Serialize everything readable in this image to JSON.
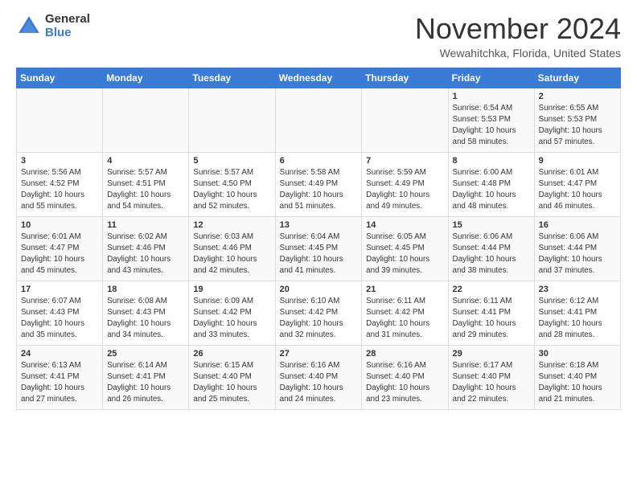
{
  "logo": {
    "general": "General",
    "blue": "Blue"
  },
  "title": "November 2024",
  "location": "Wewahitchka, Florida, United States",
  "weekdays": [
    "Sunday",
    "Monday",
    "Tuesday",
    "Wednesday",
    "Thursday",
    "Friday",
    "Saturday"
  ],
  "weeks": [
    [
      {
        "day": "",
        "info": ""
      },
      {
        "day": "",
        "info": ""
      },
      {
        "day": "",
        "info": ""
      },
      {
        "day": "",
        "info": ""
      },
      {
        "day": "",
        "info": ""
      },
      {
        "day": "1",
        "info": "Sunrise: 6:54 AM\nSunset: 5:53 PM\nDaylight: 10 hours\nand 58 minutes."
      },
      {
        "day": "2",
        "info": "Sunrise: 6:55 AM\nSunset: 5:53 PM\nDaylight: 10 hours\nand 57 minutes."
      }
    ],
    [
      {
        "day": "3",
        "info": "Sunrise: 5:56 AM\nSunset: 4:52 PM\nDaylight: 10 hours\nand 55 minutes."
      },
      {
        "day": "4",
        "info": "Sunrise: 5:57 AM\nSunset: 4:51 PM\nDaylight: 10 hours\nand 54 minutes."
      },
      {
        "day": "5",
        "info": "Sunrise: 5:57 AM\nSunset: 4:50 PM\nDaylight: 10 hours\nand 52 minutes."
      },
      {
        "day": "6",
        "info": "Sunrise: 5:58 AM\nSunset: 4:49 PM\nDaylight: 10 hours\nand 51 minutes."
      },
      {
        "day": "7",
        "info": "Sunrise: 5:59 AM\nSunset: 4:49 PM\nDaylight: 10 hours\nand 49 minutes."
      },
      {
        "day": "8",
        "info": "Sunrise: 6:00 AM\nSunset: 4:48 PM\nDaylight: 10 hours\nand 48 minutes."
      },
      {
        "day": "9",
        "info": "Sunrise: 6:01 AM\nSunset: 4:47 PM\nDaylight: 10 hours\nand 46 minutes."
      }
    ],
    [
      {
        "day": "10",
        "info": "Sunrise: 6:01 AM\nSunset: 4:47 PM\nDaylight: 10 hours\nand 45 minutes."
      },
      {
        "day": "11",
        "info": "Sunrise: 6:02 AM\nSunset: 4:46 PM\nDaylight: 10 hours\nand 43 minutes."
      },
      {
        "day": "12",
        "info": "Sunrise: 6:03 AM\nSunset: 4:46 PM\nDaylight: 10 hours\nand 42 minutes."
      },
      {
        "day": "13",
        "info": "Sunrise: 6:04 AM\nSunset: 4:45 PM\nDaylight: 10 hours\nand 41 minutes."
      },
      {
        "day": "14",
        "info": "Sunrise: 6:05 AM\nSunset: 4:45 PM\nDaylight: 10 hours\nand 39 minutes."
      },
      {
        "day": "15",
        "info": "Sunrise: 6:06 AM\nSunset: 4:44 PM\nDaylight: 10 hours\nand 38 minutes."
      },
      {
        "day": "16",
        "info": "Sunrise: 6:06 AM\nSunset: 4:44 PM\nDaylight: 10 hours\nand 37 minutes."
      }
    ],
    [
      {
        "day": "17",
        "info": "Sunrise: 6:07 AM\nSunset: 4:43 PM\nDaylight: 10 hours\nand 35 minutes."
      },
      {
        "day": "18",
        "info": "Sunrise: 6:08 AM\nSunset: 4:43 PM\nDaylight: 10 hours\nand 34 minutes."
      },
      {
        "day": "19",
        "info": "Sunrise: 6:09 AM\nSunset: 4:42 PM\nDaylight: 10 hours\nand 33 minutes."
      },
      {
        "day": "20",
        "info": "Sunrise: 6:10 AM\nSunset: 4:42 PM\nDaylight: 10 hours\nand 32 minutes."
      },
      {
        "day": "21",
        "info": "Sunrise: 6:11 AM\nSunset: 4:42 PM\nDaylight: 10 hours\nand 31 minutes."
      },
      {
        "day": "22",
        "info": "Sunrise: 6:11 AM\nSunset: 4:41 PM\nDaylight: 10 hours\nand 29 minutes."
      },
      {
        "day": "23",
        "info": "Sunrise: 6:12 AM\nSunset: 4:41 PM\nDaylight: 10 hours\nand 28 minutes."
      }
    ],
    [
      {
        "day": "24",
        "info": "Sunrise: 6:13 AM\nSunset: 4:41 PM\nDaylight: 10 hours\nand 27 minutes."
      },
      {
        "day": "25",
        "info": "Sunrise: 6:14 AM\nSunset: 4:41 PM\nDaylight: 10 hours\nand 26 minutes."
      },
      {
        "day": "26",
        "info": "Sunrise: 6:15 AM\nSunset: 4:40 PM\nDaylight: 10 hours\nand 25 minutes."
      },
      {
        "day": "27",
        "info": "Sunrise: 6:16 AM\nSunset: 4:40 PM\nDaylight: 10 hours\nand 24 minutes."
      },
      {
        "day": "28",
        "info": "Sunrise: 6:16 AM\nSunset: 4:40 PM\nDaylight: 10 hours\nand 23 minutes."
      },
      {
        "day": "29",
        "info": "Sunrise: 6:17 AM\nSunset: 4:40 PM\nDaylight: 10 hours\nand 22 minutes."
      },
      {
        "day": "30",
        "info": "Sunrise: 6:18 AM\nSunset: 4:40 PM\nDaylight: 10 hours\nand 21 minutes."
      }
    ]
  ]
}
